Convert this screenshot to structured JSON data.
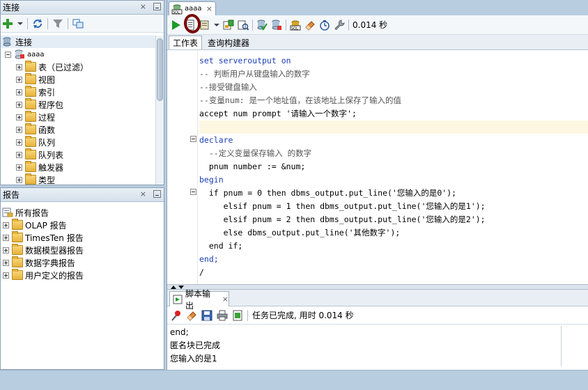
{
  "connections_panel": {
    "title": "连接",
    "close_glyph": "×",
    "tree": {
      "root_label": "连接",
      "connection_label": "aaaa",
      "items": [
        {
          "label": "表（已过滤）",
          "icon": "table-icon"
        },
        {
          "label": "视图",
          "icon": "view-icon"
        },
        {
          "label": "索引",
          "icon": "index-icon"
        },
        {
          "label": "程序包",
          "icon": "package-icon"
        },
        {
          "label": "过程",
          "icon": "procedure-icon"
        },
        {
          "label": "函数",
          "icon": "function-icon"
        },
        {
          "label": "队列",
          "icon": "queue-icon"
        },
        {
          "label": "队列表",
          "icon": "queue-table-icon"
        },
        {
          "label": "触发器",
          "icon": "trigger-icon"
        },
        {
          "label": "类型",
          "icon": "type-icon"
        }
      ]
    }
  },
  "reports_panel": {
    "title": "报告",
    "close_glyph": "×",
    "root_label": "所有报告",
    "items": [
      {
        "label": "OLAP 报告"
      },
      {
        "label": "TimesTen 报告"
      },
      {
        "label": "数据模型器报告"
      },
      {
        "label": "数据字典报告"
      },
      {
        "label": "用户定义的报告"
      }
    ]
  },
  "editor": {
    "doc_tab_label": "aaaa",
    "doc_tab_close": "×",
    "elapsed": "0.014 秒",
    "subtabs": [
      "工作表",
      "查询构建器"
    ],
    "lines": [
      {
        "text": "set serveroutput on",
        "type": "kw"
      },
      {
        "text": "-- 判断用户从键盘输入的数字",
        "type": "cm"
      },
      {
        "text": "--接受键盘输入",
        "type": "cm"
      },
      {
        "text": "--变量num: 是一个地址值，在该地址上保存了输入的值",
        "type": "cm"
      },
      {
        "text": "accept num prompt '请输入一个数字';",
        "type": "plain"
      },
      {
        "text": "",
        "type": "plain"
      },
      {
        "text": "declare",
        "type": "kw"
      },
      {
        "text": "  --定义变量保存输入 的数字",
        "type": "cm"
      },
      {
        "text": "  pnum number := &num;",
        "type": "plain"
      },
      {
        "text": "begin",
        "type": "kw"
      },
      {
        "text": "  if pnum = 0 then dbms_output.put_line('您输入的是0');",
        "type": "plain"
      },
      {
        "text": "     elsif pnum = 1 then dbms_output.put_line('您输入的是1');",
        "type": "plain"
      },
      {
        "text": "     elsif pnum = 2 then dbms_output.put_line('您输入的是2');",
        "type": "plain"
      },
      {
        "text": "     else dbms_output.put_line('其他数字');",
        "type": "plain"
      },
      {
        "text": "  end if;",
        "type": "plain"
      },
      {
        "text": "end;",
        "type": "kw"
      },
      {
        "text": "/",
        "type": "plain"
      }
    ]
  },
  "script_output": {
    "tab_label": "脚本输出",
    "tab_close": "×",
    "status": "任务已完成, 用时 0.014 秒",
    "lines": [
      "end;",
      "匿名块已完成",
      "您输入的是1"
    ]
  },
  "colors": {
    "keyword": "#1b3fb5",
    "current_line": "#fdf7e2",
    "annotation_circle": "#7a0c0c"
  }
}
